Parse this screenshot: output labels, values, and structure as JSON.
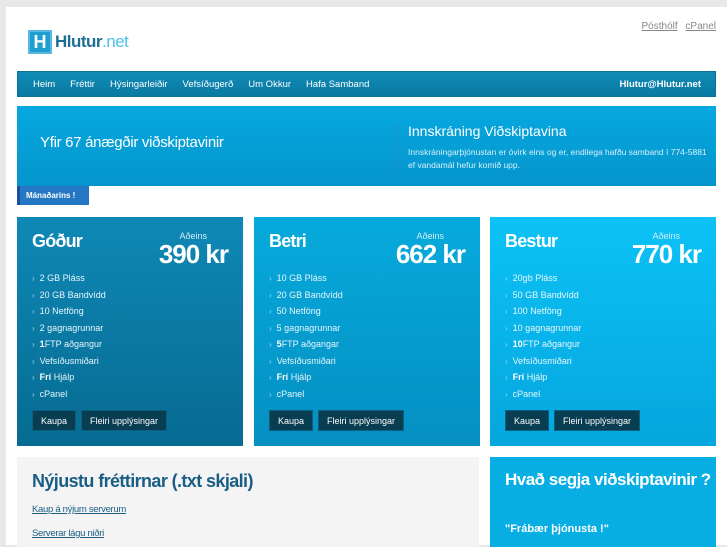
{
  "logo": {
    "icon": "H",
    "name": "Hlutur",
    "tld": ".net"
  },
  "toplinks": [
    "Pósthólf",
    "cPanel"
  ],
  "nav": {
    "items": [
      "Heim",
      "Fréttir",
      "Hýsingarleiðir",
      "Vefsíðugerð",
      "Um Okkur",
      "Hafa Samband"
    ],
    "email": "Hlutur@Hlutur.net"
  },
  "hero": {
    "headline": "Yfir 67 ánægðir viðskiptavinir",
    "login_title": "Innskráning Viðskiptavina",
    "login_text": "Innskráningarþjónustan er óvirk eins og er, endilega hafðu samband í 774-5881 ef vandamál hefur komið upp."
  },
  "tab": "Mánaðarins !",
  "plans": [
    {
      "name": "Góður",
      "only": "Aðeins",
      "price": "390 kr",
      "features": [
        "2 GB Pláss",
        "20 GB Bandvídd",
        "10 Netföng",
        "2 gagnagrunnar",
        "1FTP aðgangur",
        "Vefsíðusmiðari",
        "Frí Hjálp",
        "cPanel"
      ],
      "buy": "Kaupa",
      "more": "Fleiri upplýsingar"
    },
    {
      "name": "Betri",
      "only": "Aðeins",
      "price": "662 kr",
      "features": [
        "10 GB Pláss",
        "20 GB Bandvídd",
        "50 Netföng",
        "5 gagnagrunnar",
        "5FTP aðgangar",
        "Vefsíðusmiðari",
        "Frí Hjálp",
        "cPanel"
      ],
      "buy": "Kaupa",
      "more": "Fleiri upplýsingar"
    },
    {
      "name": "Bestur",
      "only": "Aðeins",
      "price": "770 kr",
      "features": [
        "20gb Pláss",
        "50 GB Bandvídd",
        "100 Netföng",
        "10 gagnagrunnar",
        "10FTP aðgangur",
        "Vefsíðusmiðari",
        "Frí Hjálp",
        "cPanel"
      ],
      "buy": "Kaupa",
      "more": "Fleiri upplýsingar"
    }
  ],
  "news": {
    "title": "Nýjustu fréttirnar (.txt skjali)",
    "links": [
      "Kaup á nýjum serverum",
      "Serverar lágu niðri"
    ]
  },
  "testimonial": {
    "title": "Hvað segja viðskiptavinir ?",
    "quote": "\"Frábær þjónusta !\""
  }
}
